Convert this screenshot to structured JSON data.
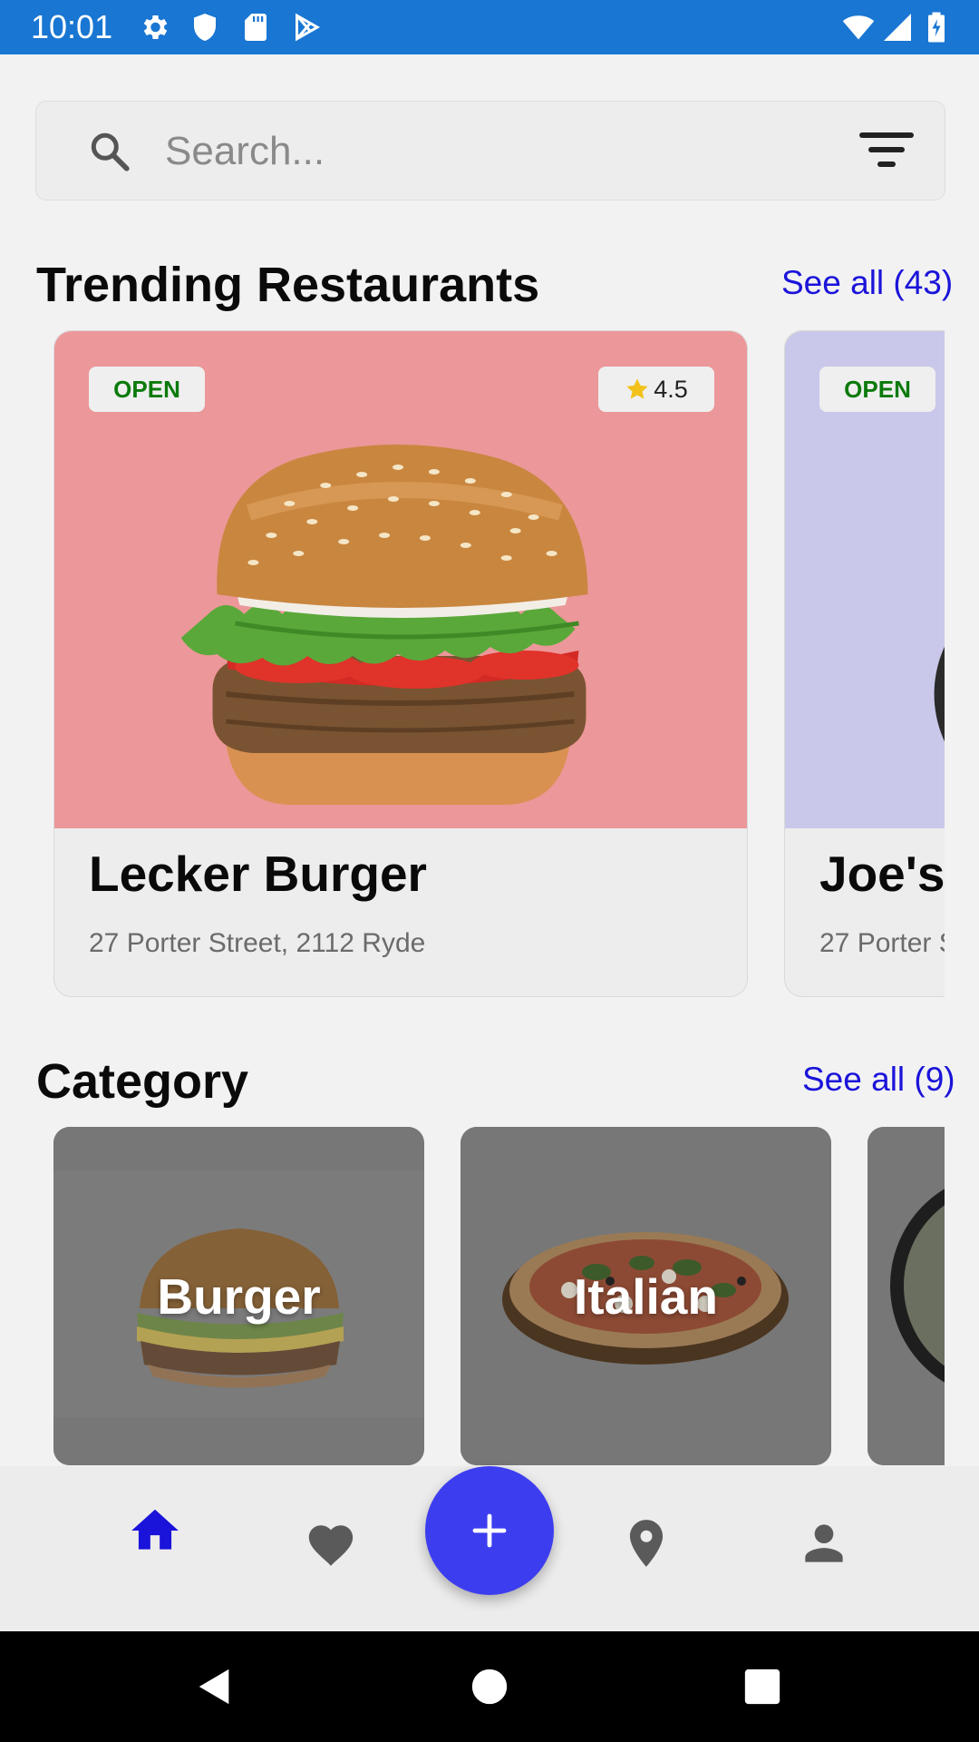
{
  "status_bar": {
    "time": "10:01",
    "icons": [
      "settings-icon",
      "shield-icon",
      "sd-card-icon",
      "play-store-icon",
      "wifi-icon",
      "signal-icon",
      "battery-icon"
    ]
  },
  "search": {
    "placeholder": "Search...",
    "value": "",
    "icon": "search-icon",
    "filter_icon": "filter-icon"
  },
  "trending": {
    "title": "Trending Restaurants",
    "see_all": "See all (43)",
    "cards": [
      {
        "status": "OPEN",
        "rating": "4.5",
        "name": "Lecker Burger",
        "address": "27 Porter Street, 2112 Ryde",
        "image_bg": "#ec9799"
      },
      {
        "status": "OPEN",
        "rating": "",
        "name": "Joe's",
        "address": "27 Porter S",
        "image_bg": "#c9c8ea"
      }
    ]
  },
  "category": {
    "title": "Category",
    "see_all": "See all (9)",
    "items": [
      {
        "label": "Burger"
      },
      {
        "label": "Italian"
      },
      {
        "label": ""
      }
    ]
  },
  "bottom_nav": {
    "items": [
      "home-icon",
      "heart-icon",
      "add-icon",
      "location-icon",
      "profile-icon"
    ],
    "active_color": "#1a13d9",
    "inactive_color": "#5a5a5a",
    "fab_color": "#3d3df0"
  },
  "colors": {
    "status_bar": "#1976d2",
    "link": "#1a13d9",
    "open_badge_text": "#0b7a0b",
    "background": "#f2f2f2"
  }
}
